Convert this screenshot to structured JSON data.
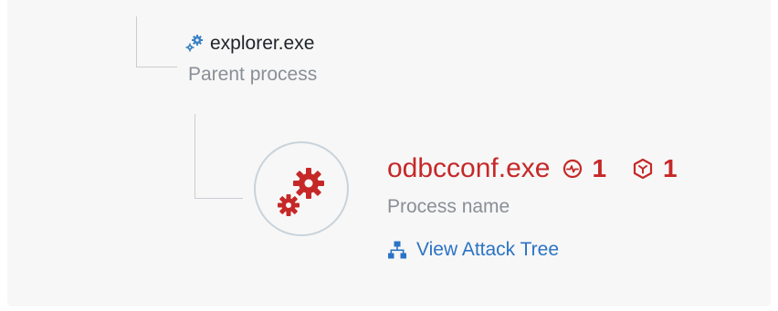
{
  "parent": {
    "name": "explorer.exe",
    "subtitle": "Parent process"
  },
  "process": {
    "name": "odbcconf.exe",
    "subtitle": "Process name",
    "detections": "1",
    "alerts": "1"
  },
  "attack_tree_link": "View Attack Tree",
  "colors": {
    "accent_red": "#c62828",
    "link_blue": "#2b73c4",
    "parent_icon_blue": "#3b82c4",
    "muted_text": "#8a8f96"
  },
  "icons": {
    "parent": "gears-icon",
    "process": "gears-icon",
    "detection": "activity-circle-icon",
    "alert": "hexagon-alert-icon",
    "attack_tree": "hierarchy-icon"
  }
}
